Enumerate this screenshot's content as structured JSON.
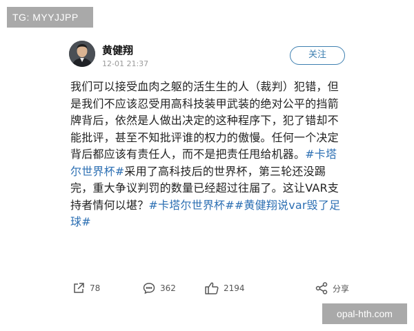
{
  "watermarks": {
    "top_left": "TG: MYYJJPP",
    "bottom_right": "opal-hth.com"
  },
  "post": {
    "author": "黄健翔",
    "time": "12-01 21:37",
    "follow_label": "关注",
    "content_segments": [
      {
        "type": "text",
        "text": "我们可以接受血肉之躯的活生生的人（裁判）犯错，但是我们不应该忍受用高科技装甲武装的绝对公平的挡箭牌背后，依然是人做出决定的这种程序下，犯了错却不能批评，甚至不知批评谁的权力的傲慢。任何一个决定背后都应该有责任人，而不是把责任甩给机器。"
      },
      {
        "type": "tag",
        "text": "#卡塔尔世界杯#"
      },
      {
        "type": "text",
        "text": "采用了高科技后的世界杯，第三轮还没踢完，重大争议判罚的数量已经超过往届了。这让VAR支持者情何以堪？"
      },
      {
        "type": "tag",
        "text": "#卡塔尔世界杯#"
      },
      {
        "type": "tag",
        "text": "#黄健翔说var毁了足球#"
      }
    ],
    "actions": {
      "repost": {
        "icon": "share-arrow-icon",
        "count": "78"
      },
      "comment": {
        "icon": "comment-bubble-icon",
        "count": "362"
      },
      "like": {
        "icon": "thumbs-up-icon",
        "count": "2194"
      },
      "share": {
        "icon": "share-nodes-icon",
        "label": "分享"
      }
    }
  }
}
